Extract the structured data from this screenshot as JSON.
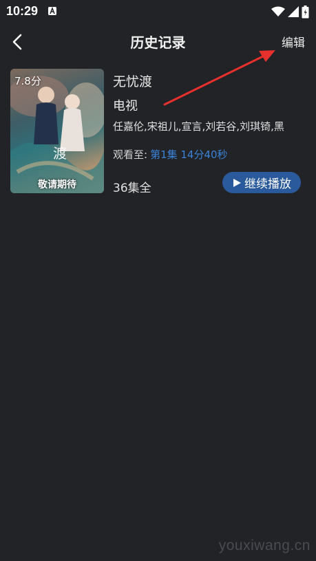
{
  "status_bar": {
    "time": "10:29",
    "icons": [
      "wifi-icon",
      "signal-icon",
      "battery-icon"
    ]
  },
  "header": {
    "title": "历史记录",
    "edit_label": "编辑",
    "back_icon": "chevron-left-icon"
  },
  "history": [
    {
      "score": "7.8分",
      "poster_caption": "敬请期待",
      "title": "无忧渡",
      "type": "电视",
      "cast": "任嘉伦,宋祖儿,宣言,刘若谷,刘琪锜,黑",
      "watch_label": "观看至:",
      "watch_progress": "第1集 14分40秒",
      "episodes": "36集全",
      "continue_label": "继续播放",
      "continue_icon": "play-icon"
    }
  ],
  "watermark": "youxiwang.cn",
  "colors": {
    "background": "#222326",
    "accent": "#3a83d9",
    "button": "#2a5a9c",
    "annotation": "#e8302c"
  }
}
